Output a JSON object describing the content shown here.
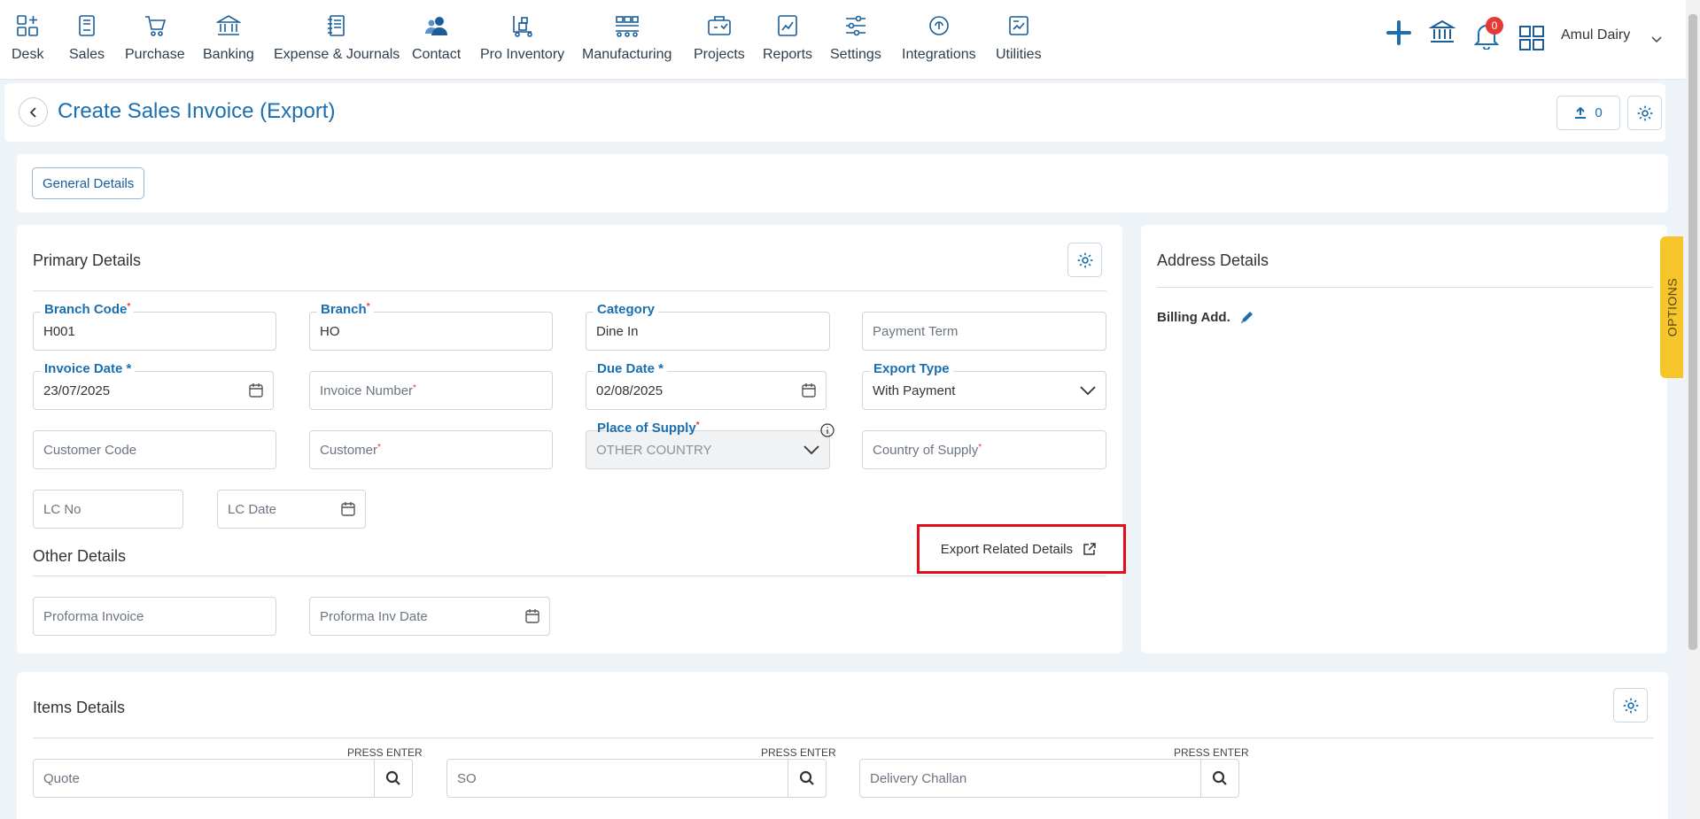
{
  "nav": {
    "items": [
      {
        "label": "Desk",
        "icon": "desk-icon"
      },
      {
        "label": "Sales",
        "icon": "sales-icon"
      },
      {
        "label": "Purchase",
        "icon": "purchase-cart-icon"
      },
      {
        "label": "Banking",
        "icon": "bank-icon"
      },
      {
        "label": "Expense & Journals",
        "icon": "journal-icon"
      },
      {
        "label": "Contact",
        "icon": "contact-icon"
      },
      {
        "label": "Pro Inventory",
        "icon": "inventory-icon"
      },
      {
        "label": "Manufacturing",
        "icon": "manufacturing-icon"
      },
      {
        "label": "Projects",
        "icon": "projects-icon"
      },
      {
        "label": "Reports",
        "icon": "reports-icon"
      },
      {
        "label": "Settings",
        "icon": "settings-sliders-icon"
      },
      {
        "label": "Integrations",
        "icon": "integrations-icon"
      },
      {
        "label": "Utilities",
        "icon": "utilities-icon"
      }
    ],
    "notification_count": "0",
    "username": "Amul Dairy"
  },
  "header": {
    "title": "Create Sales Invoice (Export)",
    "upload_count": "0"
  },
  "tabs": {
    "general": "General Details"
  },
  "primary": {
    "title": "Primary Details",
    "branch_code": {
      "label": "Branch Code",
      "value": "H001"
    },
    "branch": {
      "label": "Branch",
      "value": "HO"
    },
    "category": {
      "label": "Category",
      "value": "Dine In"
    },
    "payment_term": {
      "placeholder": "Payment Term"
    },
    "invoice_date": {
      "label": "Invoice Date *",
      "value": "23/07/2025"
    },
    "invoice_number": {
      "placeholder": "Invoice Number"
    },
    "due_date": {
      "label": "Due Date *",
      "value": "02/08/2025"
    },
    "export_type": {
      "label": "Export Type",
      "value": "With Payment"
    },
    "customer_code": {
      "placeholder": "Customer Code"
    },
    "customer": {
      "placeholder": "Customer"
    },
    "place_of_supply": {
      "label": "Place of Supply",
      "value": "OTHER COUNTRY"
    },
    "country_of_supply": {
      "placeholder": "Country of Supply"
    },
    "lc_no": {
      "placeholder": "LC No"
    },
    "lc_date": {
      "placeholder": "LC Date"
    }
  },
  "other": {
    "title": "Other Details",
    "export_link": "Export Related Details",
    "proforma_invoice": {
      "placeholder": "Proforma Invoice"
    },
    "proforma_inv_date": {
      "placeholder": "Proforma Inv Date"
    }
  },
  "address": {
    "title": "Address Details",
    "billing": "Billing Add."
  },
  "options_tab": "OPTIONS",
  "items": {
    "title": "Items Details",
    "press_enter": "PRESS ENTER",
    "quote": "Quote",
    "so": "SO",
    "delivery_challan": "Delivery Challan"
  }
}
